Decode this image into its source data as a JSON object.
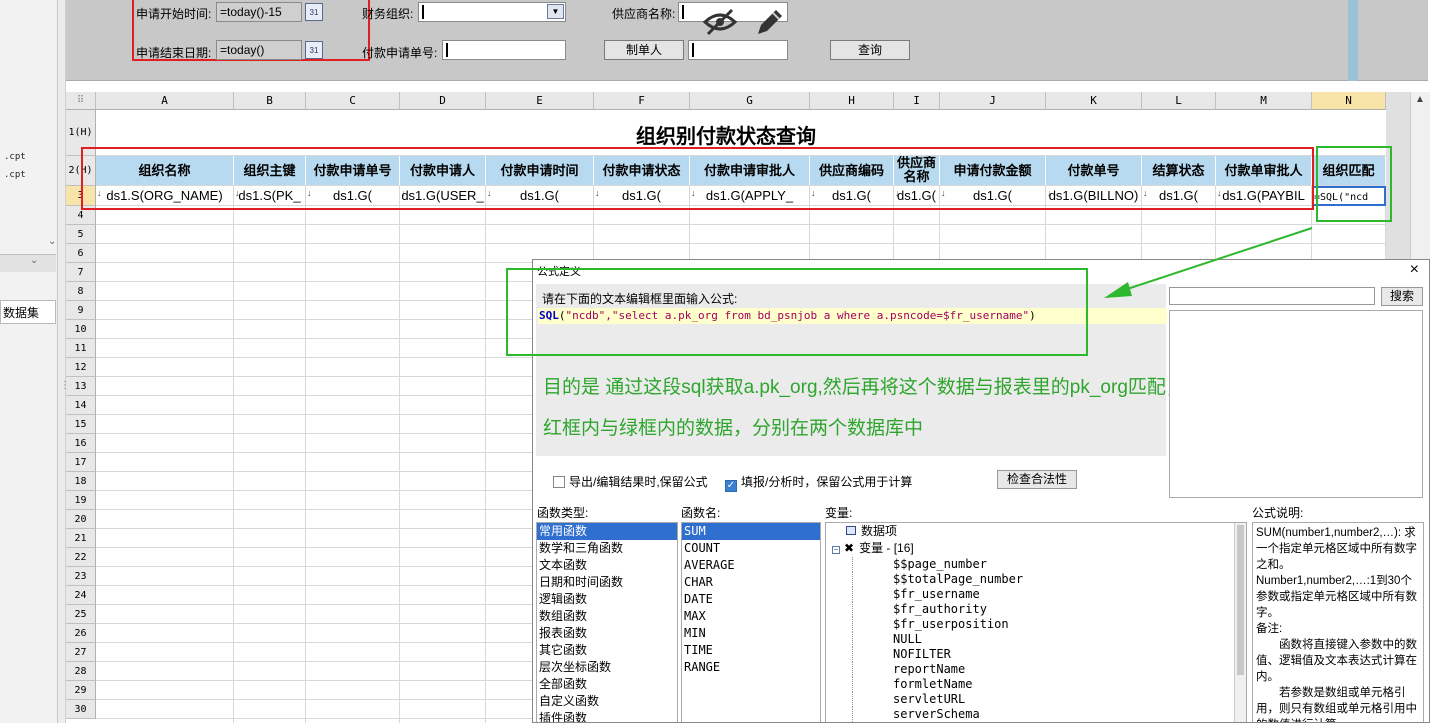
{
  "left_panel": {
    "files": [
      ".cpt",
      ".cpt"
    ],
    "tab_label": "数据集"
  },
  "params": {
    "start_label": "申请开始时间:",
    "start_value": "=today()-15",
    "end_label": "申请结束日期:",
    "end_value": "=today()",
    "org_label": "财务组织:",
    "payno_label": "付款申请单号:",
    "supplier_label": "供应商名称:",
    "creator_label": "制单人",
    "query_button": "查询",
    "calendar_glyph": "31"
  },
  "sheet": {
    "corner": "⠿",
    "columns": [
      "A",
      "B",
      "C",
      "D",
      "E",
      "F",
      "G",
      "H",
      "I",
      "J",
      "K",
      "L",
      "M",
      "N"
    ],
    "row_labels": [
      "1(H)",
      "2(H)",
      "3",
      "4",
      "5",
      "6",
      "7",
      "8",
      "9",
      "10",
      "11",
      "12",
      "13",
      "14",
      "15",
      "16",
      "17",
      "18",
      "19",
      "20",
      "21",
      "22",
      "23",
      "24",
      "25",
      "26",
      "27",
      "28",
      "29",
      "30"
    ],
    "title": "组织别付款状态查询",
    "headers": [
      "组织名称",
      "组织主键",
      "付款申请单号",
      "付款申请人",
      "付款申请时间",
      "付款申请状态",
      "付款申请审批人",
      "供应商编码",
      "供应商名称",
      "申请付款金额",
      "付款单号",
      "结算状态",
      "付款单审批人",
      "组织匹配"
    ],
    "data_row": [
      "ds1.S(ORG_NAME)",
      "ds1.S(PK_",
      "ds1.G(",
      "ds1.G(USER_",
      "ds1.G(",
      "ds1.G(",
      "ds1.G(APPLY_",
      "ds1.G(",
      "ds1.G(",
      "ds1.G(",
      "ds1.G(BILLNO)",
      "ds1.G(",
      "ds1.G(PAYBIL",
      "=SQL(\"ncd"
    ],
    "expand_marker": "↓"
  },
  "dialog": {
    "title": "公式定义",
    "close": "×",
    "prompt": "请在下面的文本编辑框里面输入公式:",
    "formula_fn": "SQL",
    "formula_open": "(",
    "formula_args": "\"ncdb\",\"select a.pk_org from bd_psnjob a where a.psncode=$fr_username\"",
    "formula_close": ")",
    "note1": "目的是 通过这段sql获取a.pk_org,然后再将这个数据与报表里的pk_org匹配，达到过滤的效果",
    "note2": "红框内与绿框内的数据，分别在两个数据库中",
    "search_button": "搜索",
    "check1": "导出/编辑结果时,保留公式",
    "check2": "填报/分析时，保留公式用于计算",
    "check_button": "检查合法性",
    "check_mark": "✓",
    "fn_type_label": "函数类型:",
    "fn_name_label": "函数名:",
    "var_label": "变量:",
    "desc_label": "公式说明:",
    "fn_types": [
      "常用函数",
      "数学和三角函数",
      "文本函数",
      "日期和时间函数",
      "逻辑函数",
      "数组函数",
      "报表函数",
      "其它函数",
      "层次坐标函数",
      "全部函数",
      "自定义函数",
      "插件函数"
    ],
    "fn_names": [
      "SUM",
      "COUNT",
      "AVERAGE",
      "CHAR",
      "DATE",
      "MAX",
      "MIN",
      "TIME",
      "RANGE"
    ],
    "var_root": "数据项",
    "var_group": "变量 - [16]",
    "var_toggle": "−",
    "var_items": [
      "$$page_number",
      "$$totalPage_number",
      "$fr_username",
      "$fr_authority",
      "$fr_userposition",
      "NULL",
      "NOFILTER",
      "reportName",
      "formletName",
      "servletURL",
      "serverSchema"
    ],
    "desc_lines": [
      "SUM(number1,number2,…): 求一个指定单元格区域中所有数字之和。",
      "Number1,number2,…:1到30个参数或指定单元格区域中所有数字。",
      "备注:",
      "　　函数将直接键入参数中的数值、逻辑值及文本表达式计算在内。",
      "　　若参数是数组或单元格引用，则只有数组或单元格引用中的数值进行计算。"
    ]
  },
  "colors": {
    "header_fill": "#b8daf0",
    "red_annot": "#e02020",
    "green_annot": "#2eb82e",
    "selected_blue": "#2f6fd0"
  }
}
